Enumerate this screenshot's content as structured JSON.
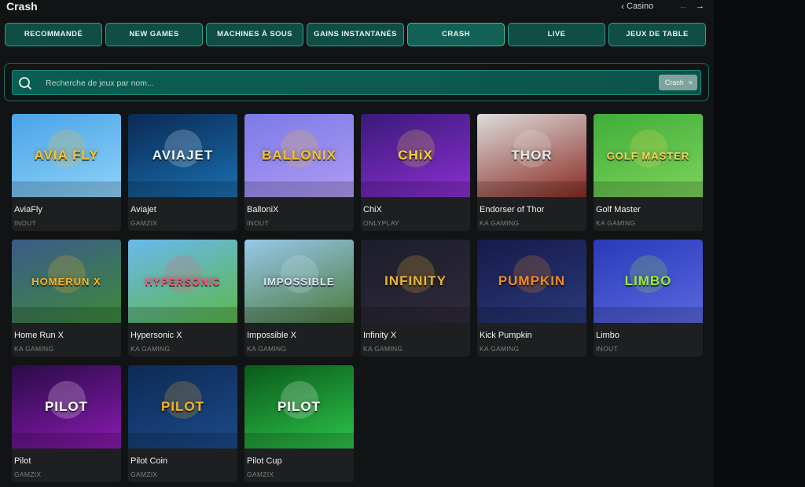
{
  "header": {
    "title": "Crash",
    "breadcrumb": "Casino",
    "prev_arrow": "←",
    "next_arrow": "→"
  },
  "tabs": [
    {
      "label": "RECOMMANDÉ"
    },
    {
      "label": "NEW GAMES"
    },
    {
      "label": "MACHINES À SOUS"
    },
    {
      "label": "GAINS INSTANTANÉS"
    },
    {
      "label": "CRASH",
      "active": true
    },
    {
      "label": "LIVE"
    },
    {
      "label": "JEUX DE TABLE"
    }
  ],
  "search": {
    "placeholder": "Recherche de jeux par nom...",
    "value": "",
    "filter_chip": "Crash",
    "filter_close": "×"
  },
  "games": [
    {
      "name": "AviaFly",
      "provider": "INOUT",
      "logo": "AVIA FLY",
      "bg": [
        "#4aa4e8",
        "#8fd2f7"
      ],
      "accent": "#f7c12a"
    },
    {
      "name": "Aviajet",
      "provider": "GAMZIX",
      "logo": "AVIAJET",
      "bg": [
        "#0a2a55",
        "#1a6fb0"
      ],
      "accent": "#e8f4ff"
    },
    {
      "name": "BalloniX",
      "provider": "INOUT",
      "logo": "BALLONIX",
      "bg": [
        "#7b7be8",
        "#b09af2"
      ],
      "accent": "#f6c125"
    },
    {
      "name": "ChiX",
      "provider": "ONLYPLAY",
      "logo": "CHiX",
      "bg": [
        "#3a1a7a",
        "#8b2fd0"
      ],
      "accent": "#f0d43a"
    },
    {
      "name": "Endorser of Thor",
      "provider": "KA GAMING",
      "logo": "THOR",
      "bg": [
        "#dcdcdc",
        "#8a2a22"
      ],
      "accent": "#e8e8e8"
    },
    {
      "name": "Golf Master",
      "provider": "KA GAMING",
      "logo": "GOLF MASTER",
      "bg": [
        "#3fae3a",
        "#7ed35a"
      ],
      "accent": "#f5d35a"
    },
    {
      "name": "Home Run X",
      "provider": "KA GAMING",
      "logo": "HOMERUN X",
      "bg": [
        "#3b5b8a",
        "#3e8a3a"
      ],
      "accent": "#f5b52a"
    },
    {
      "name": "Hypersonic X",
      "provider": "KA GAMING",
      "logo": "HYPERSONIC",
      "bg": [
        "#6ab8ee",
        "#5cb84a"
      ],
      "accent": "#f35a7a"
    },
    {
      "name": "Impossible X",
      "provider": "KA GAMING",
      "logo": "IMPOSSIBLE",
      "bg": [
        "#98c8ea",
        "#4a7a3a"
      ],
      "accent": "#d7e6f6"
    },
    {
      "name": "Infinity X",
      "provider": "KA GAMING",
      "logo": "INFINITY",
      "bg": [
        "#1b1d2a",
        "#302a3a"
      ],
      "accent": "#e7b63a"
    },
    {
      "name": "Kick Pumpkin",
      "provider": "KA GAMING",
      "logo": "PUMPKIN",
      "bg": [
        "#161a4a",
        "#2a3a7a"
      ],
      "accent": "#f08a22"
    },
    {
      "name": "Limbo",
      "provider": "INOUT",
      "logo": "LIMBO",
      "bg": [
        "#2a3ab8",
        "#5a68e0"
      ],
      "accent": "#9be83a"
    },
    {
      "name": "Pilot",
      "provider": "GAMZIX",
      "logo": "PILOT",
      "bg": [
        "#2a0b48",
        "#8a1ab0"
      ],
      "accent": "#ffffff"
    },
    {
      "name": "Pilot Coin",
      "provider": "GAMZIX",
      "logo": "PILOT",
      "bg": [
        "#0d2a55",
        "#1c4a8a"
      ],
      "accent": "#f3b62a"
    },
    {
      "name": "Pilot Cup",
      "provider": "GAMZIX",
      "logo": "PILOT",
      "bg": [
        "#0a5a1a",
        "#2ec24a"
      ],
      "accent": "#ffffff"
    }
  ]
}
